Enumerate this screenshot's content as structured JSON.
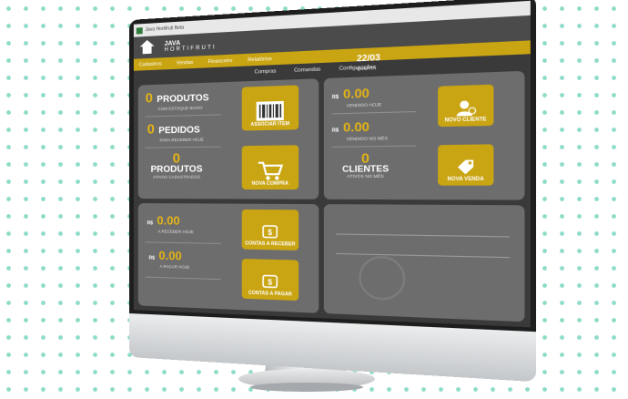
{
  "window": {
    "title": "Java Hortifruti Beta"
  },
  "brand": {
    "line1": "JAVA",
    "line2": "HORTIFRUTI"
  },
  "menu": [
    "Cadastros",
    "Vendas",
    "Financeiro",
    "Relatórios"
  ],
  "toolbar": {
    "date": "22/03",
    "date_label": "QUARTA",
    "items": [
      "Compras",
      "Comandas",
      "Configurações"
    ]
  },
  "products_panel": {
    "rows": [
      {
        "value": "0",
        "label": "PRODUTOS",
        "sub": "COM ESTOQUE BAIXO"
      },
      {
        "value": "0",
        "label": "PEDIDOS",
        "sub": "PARA RECEBER HOJE"
      },
      {
        "value": "0",
        "label": "PRODUTOS",
        "sub": "ATIVOS CADASTRADOS"
      }
    ],
    "buttons": [
      "ASSOCIAR ITEM",
      "NOVA COMPRA"
    ]
  },
  "finance_panel": {
    "rows": [
      {
        "currency": "R$",
        "value": "0.00",
        "sub": "A RECEBER HOJE"
      },
      {
        "currency": "R$",
        "value": "0.00",
        "sub": "A PAGAR HOJE"
      }
    ],
    "buttons": [
      "CONTAS A RECEBER",
      "CONTAS A PAGAR"
    ]
  },
  "sales_panel": {
    "rows": [
      {
        "currency": "R$",
        "value": "0.00",
        "sub": "VENDIDO HOJE"
      },
      {
        "currency": "R$",
        "value": "0.00",
        "sub": "VENDIDO NO MÊS"
      }
    ],
    "clients": {
      "value": "0",
      "label": "CLIENTES",
      "sub": "ATIVOS NO MÊS"
    },
    "buttons": [
      "NOVO CLIENTE",
      "NOVA VENDA"
    ]
  },
  "colors": {
    "accent": "#c9a413",
    "panel": "#6d6d6d",
    "value": "#e3b315",
    "dots": "#8fdcc9"
  }
}
